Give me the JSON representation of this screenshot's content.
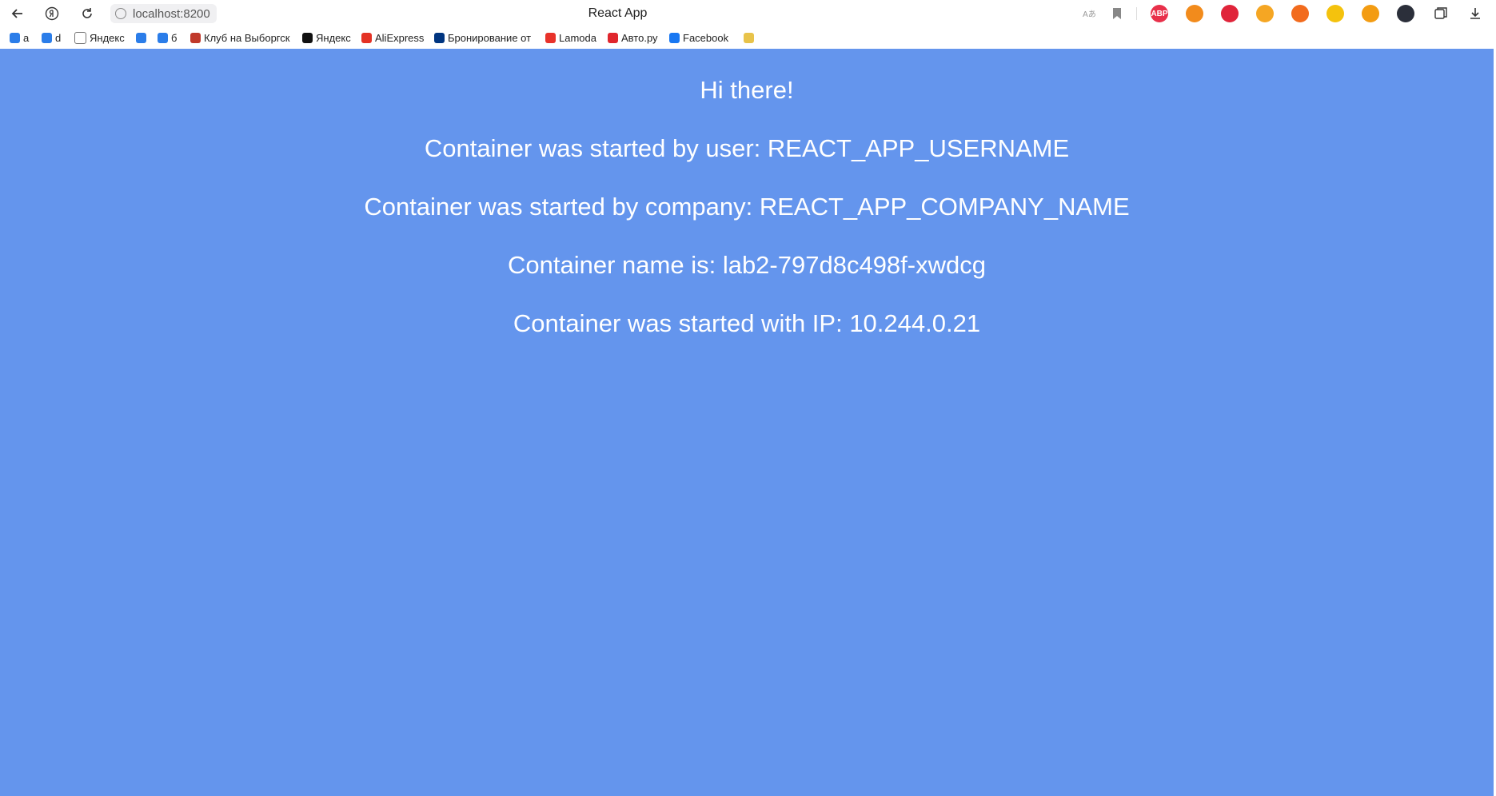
{
  "browser": {
    "address": "localhost:8200",
    "tab_title": "React App",
    "icons": {
      "back": "arrow-left-icon",
      "yandex": "yandex-logo-icon",
      "reload": "reload-icon",
      "translate": "translate-icon",
      "bookmark": "bookmark-icon",
      "collections": "collections-icon",
      "download": "download-icon"
    },
    "extensions": [
      {
        "name": "adblock-plus-icon",
        "label": "ABP",
        "color": "#e8304a"
      },
      {
        "name": "metamask-icon",
        "label": "",
        "color": "#f28b1c"
      },
      {
        "name": "red-square-extension-icon",
        "label": "",
        "color": "#e0243a"
      },
      {
        "name": "orange-search-extension-icon",
        "label": "",
        "color": "#f5a623"
      },
      {
        "name": "fire-extension-icon",
        "label": "",
        "color": "#f26b1d"
      },
      {
        "name": "hand-extension-icon",
        "label": "",
        "color": "#f4c20d"
      },
      {
        "name": "coin-extension-icon",
        "label": "",
        "color": "#f39c12"
      },
      {
        "name": "dark-circle-extension-icon",
        "label": "",
        "color": "#2b2f3a"
      }
    ]
  },
  "bookmarks": [
    {
      "label": "а",
      "icon": "chat-bubble-icon",
      "color": "#2b7de9"
    },
    {
      "label": "d",
      "icon": "chat-bubble-icon",
      "color": "#2b7de9"
    },
    {
      "label": "Яндекс",
      "icon": "document-icon",
      "color": "#ffffff"
    },
    {
      "label": "",
      "icon": "chat-bubble-icon",
      "color": "#2b7de9"
    },
    {
      "label": "б",
      "icon": "chat-bubble-icon",
      "color": "#2b7de9"
    },
    {
      "label": "Клуб на Выборгск",
      "icon": "club-icon",
      "color": "#c0392b"
    },
    {
      "label": "Яндекс",
      "icon": "plus-circle-icon",
      "color": "#111111"
    },
    {
      "label": "AliExpress",
      "icon": "aliexpress-icon",
      "color": "#e43225"
    },
    {
      "label": "Бронирование от",
      "icon": "booking-icon",
      "color": "#003580"
    },
    {
      "label": "Lamoda",
      "icon": "lamoda-icon",
      "color": "#e8322a"
    },
    {
      "label": "Авто.ру",
      "icon": "autoru-icon",
      "color": "#e0262d"
    },
    {
      "label": "Facebook",
      "icon": "facebook-icon",
      "color": "#1877f2"
    },
    {
      "label": "",
      "icon": "folder-icon",
      "color": "#e8c34a"
    }
  ],
  "page": {
    "background": "#6495ED",
    "greeting": "Hi there!",
    "user_line": "Container was started by user: REACT_APP_USERNAME",
    "company_line": "Container was started by company: REACT_APP_COMPANY_NAME",
    "name_line": "Container name is: lab2-797d8c498f-xwdcg",
    "ip_line": "Container was started with IP: 10.244.0.21"
  }
}
